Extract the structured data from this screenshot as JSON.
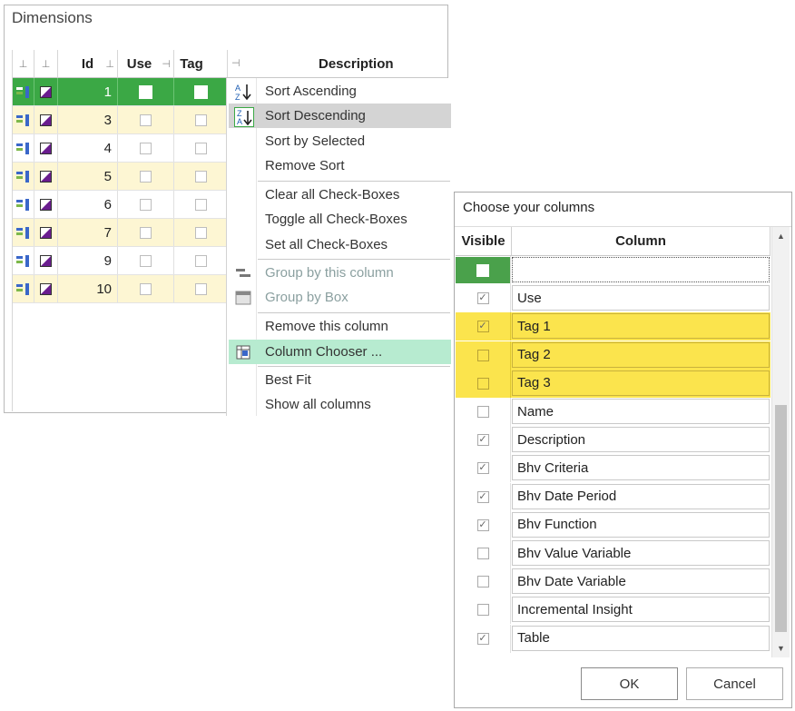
{
  "dimensions": {
    "title": "Dimensions",
    "headers": {
      "id": "Id",
      "use": "Use",
      "tag": "Tag",
      "description": "Description"
    },
    "rows": [
      {
        "id": "1",
        "selected": true
      },
      {
        "id": "3",
        "selected": false
      },
      {
        "id": "4",
        "selected": false
      },
      {
        "id": "5",
        "selected": false
      },
      {
        "id": "6",
        "selected": false
      },
      {
        "id": "7",
        "selected": false
      },
      {
        "id": "9",
        "selected": false
      },
      {
        "id": "10",
        "selected": false
      }
    ]
  },
  "context_menu": {
    "items": [
      {
        "label": "Sort Ascending",
        "icon": "sort-ascending-icon"
      },
      {
        "label": "Sort Descending",
        "icon": "sort-descending-icon",
        "highlight": "gray"
      },
      {
        "label": "Sort by Selected"
      },
      {
        "label": "Remove Sort"
      },
      {
        "label": "Clear all Check-Boxes"
      },
      {
        "label": "Toggle all Check-Boxes"
      },
      {
        "label": "Set all Check-Boxes"
      },
      {
        "label": "Group by this column",
        "icon": "group-by-column-icon",
        "disabled": true
      },
      {
        "label": "Group by Box",
        "icon": "group-by-box-icon",
        "disabled": true
      },
      {
        "label": "Remove this column"
      },
      {
        "label": "Column Chooser ...",
        "icon": "column-chooser-icon",
        "highlight": "green"
      },
      {
        "label": "Best Fit"
      },
      {
        "label": "Show all columns"
      }
    ]
  },
  "column_chooser": {
    "title": "Choose your columns",
    "headers": {
      "visible": "Visible",
      "column": "Column"
    },
    "rows": [
      {
        "name": "",
        "checked": false,
        "state": "current"
      },
      {
        "name": "Use",
        "checked": true
      },
      {
        "name": "Tag 1",
        "checked": true,
        "highlight": true
      },
      {
        "name": "Tag 2",
        "checked": false,
        "highlight": true
      },
      {
        "name": "Tag 3",
        "checked": false,
        "highlight": true
      },
      {
        "name": "Name",
        "checked": false
      },
      {
        "name": "Description",
        "checked": true
      },
      {
        "name": "Bhv Criteria",
        "checked": true
      },
      {
        "name": "Bhv Date Period",
        "checked": true
      },
      {
        "name": "Bhv Function",
        "checked": true
      },
      {
        "name": "Bhv Value Variable",
        "checked": false
      },
      {
        "name": "Bhv Date Variable",
        "checked": false
      },
      {
        "name": "Incremental Insight",
        "checked": false
      },
      {
        "name": "Table",
        "checked": true
      }
    ],
    "ok_label": "OK",
    "cancel_label": "Cancel"
  },
  "colors": {
    "selected_green": "#3ba845",
    "alt_row": "#fdf6d3",
    "highlight_yellow": "#fbe44d",
    "menu_green": "#b7ebd0"
  }
}
